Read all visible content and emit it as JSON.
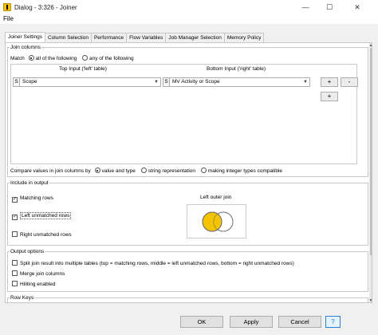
{
  "window": {
    "title": "Dialog - 3:326 - Joiner",
    "minimize": "—",
    "maximize": "☐",
    "close": "✕"
  },
  "menu": {
    "file": "File"
  },
  "tabs": [
    {
      "label": "Joiner Settings"
    },
    {
      "label": "Column Selection"
    },
    {
      "label": "Performance"
    },
    {
      "label": "Flow Variables"
    },
    {
      "label": "Job Manager Selection"
    },
    {
      "label": "Memory Policy"
    }
  ],
  "join_columns": {
    "legend": "Join columns",
    "match_label": "Match",
    "match_all": "all of the following",
    "match_any": "any of the following",
    "top_input_header": "Top Input ('left' table)",
    "bottom_input_header": "Bottom Input ('right' table)",
    "left_column": {
      "badge": "S",
      "value": "Scope"
    },
    "right_column": {
      "badge": "S",
      "value": "MV Activity or Scope"
    },
    "add_button": "+",
    "remove_button": "-",
    "add_row_button": "+",
    "compare_label": "Compare values in join columns by",
    "compare_value_type": "value and type",
    "compare_string": "string representation",
    "compare_integer": "making integer types compatible"
  },
  "include_output": {
    "legend": "Include in output",
    "matching_rows": "Matching rows",
    "left_unmatched": "Left unmatched rows",
    "right_unmatched": "Right unmatched rows",
    "join_type": "Left outer join",
    "matching_checked": "✓",
    "left_checked": "✓"
  },
  "output_options": {
    "legend": "Output options",
    "split": "Split join result into multiple tables (top = matching rows, middle = left unmatched rows, bottom = right unmatched rows)",
    "merge": "Merge join columns",
    "hiliting": "Hiliting enabled"
  },
  "row_keys": {
    "legend": "Row Keys"
  },
  "buttons": {
    "ok": "OK",
    "apply": "Apply",
    "cancel": "Cancel",
    "help": "?"
  },
  "colors": {
    "venn_fill": "#f4c400",
    "venn_stroke": "#6f6f6f",
    "accent": "#2b7cd3"
  }
}
